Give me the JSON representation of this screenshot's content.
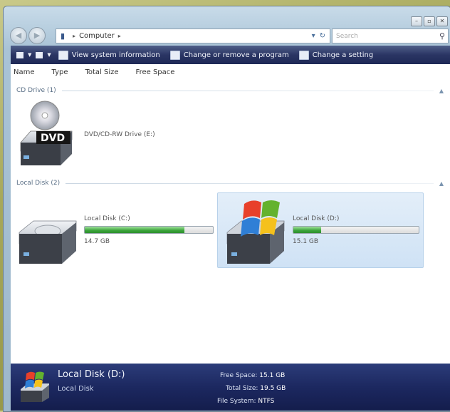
{
  "window": {
    "controls": [
      "–",
      "▫",
      "✕"
    ]
  },
  "address": {
    "path": "Computer",
    "search_placeholder": "Search"
  },
  "toolbar": {
    "items": [
      {
        "label": "View system information",
        "icon": "system-info-icon"
      },
      {
        "label": "Change or remove a program",
        "icon": "programs-icon"
      },
      {
        "label": "Change a setting",
        "icon": "settings-icon"
      }
    ]
  },
  "columns": [
    "Name",
    "Type",
    "Total Size",
    "Free Space"
  ],
  "groups": {
    "cd": "CD Drive (1)",
    "local": "Local Disk (2)"
  },
  "dvd": {
    "name": "DVD/CD-RW Drive (E:)",
    "badge": "DVD"
  },
  "disks": [
    {
      "name": "Local Disk (C:)",
      "free": "14.7 GB",
      "used_fraction": 0.78
    },
    {
      "name": "Local Disk (D:)",
      "free": "15.1 GB",
      "used_fraction": 0.22
    }
  ],
  "details": {
    "title": "Local Disk (D:)",
    "subtitle": "Local Disk",
    "free_label": "Free Space:",
    "free_value": "15.1 GB",
    "total_label": "Total Size:",
    "total_value": "19.5 GB",
    "fs_label": "File System:",
    "fs_value": "NTFS"
  },
  "colors": {
    "toolbar": "#2a3564",
    "bar_fill": "#3aa33a",
    "selection": "#cfe2f5"
  }
}
